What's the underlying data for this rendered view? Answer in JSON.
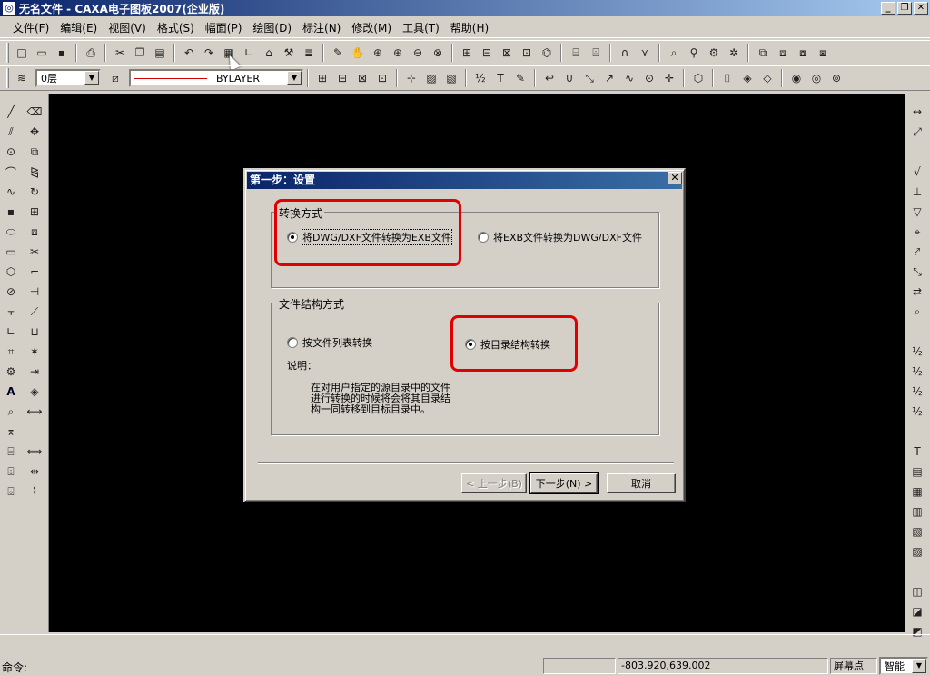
{
  "window": {
    "title": "无名文件 - CAXA电子图板2007(企业版)",
    "app_icon": "caxa-logo-icon",
    "minimize": "_",
    "maximize": "❐",
    "close": "✕"
  },
  "menu": {
    "items": [
      {
        "label": "文件(F)"
      },
      {
        "label": "编辑(E)"
      },
      {
        "label": "视图(V)"
      },
      {
        "label": "格式(S)"
      },
      {
        "label": "幅面(P)"
      },
      {
        "label": "绘图(D)"
      },
      {
        "label": "标注(N)"
      },
      {
        "label": "修改(M)"
      },
      {
        "label": "工具(T)"
      },
      {
        "label": "帮助(H)"
      }
    ]
  },
  "toolbar2": {
    "layer": "0层",
    "linetype": "BYLAYER"
  },
  "status": {
    "command_label": "命令:",
    "coordinates": "-803.920,639.002",
    "snap_label": "屏幕点",
    "snap_mode": "智能"
  },
  "dialog": {
    "title": "第一步：设置",
    "group1": {
      "legend": "转换方式",
      "option_a": "将DWG/DXF文件转换为EXB文件",
      "option_b": "将EXB文件转换为DWG/DXF文件",
      "selected": "option_a"
    },
    "group2": {
      "legend": "文件结构方式",
      "option_a": "按文件列表转换",
      "option_b": "按目录结构转换",
      "selected": "option_b",
      "note_label": "说明：",
      "note_lines": [
        "在对用户指定的源目录中的文件",
        "进行转换的时候将会将其目录结",
        "构一同转移到目标目录中。"
      ]
    },
    "buttons": {
      "back": "< 上一步(B)",
      "next": "下一步(N) >",
      "cancel": "取消"
    }
  },
  "colors": {
    "highlight": "#e00000",
    "title_bar": "#0a246a",
    "canvas": "#000000"
  }
}
